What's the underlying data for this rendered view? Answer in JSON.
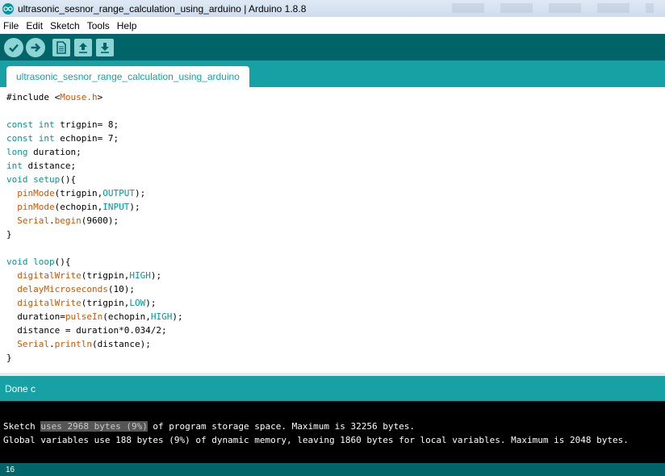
{
  "window": {
    "title": "ultrasonic_sesnor_range_calculation_using_arduino | Arduino 1.8.8",
    "icon": "arduino-logo-icon"
  },
  "menu": [
    "File",
    "Edit",
    "Sketch",
    "Tools",
    "Help"
  ],
  "toolbar": {
    "buttons": [
      "verify-icon",
      "upload-icon",
      "new-icon",
      "open-icon",
      "save-icon"
    ]
  },
  "tabs": [
    "ultrasonic_sesnor_range_calculation_using_arduino"
  ],
  "editor": {
    "lines": [
      "#include <Mouse.h>",
      "",
      "const int trigpin= 8;",
      "const int echopin= 7;",
      "long duration;",
      "int distance;",
      "void setup(){",
      "  pinMode(trigpin,OUTPUT);",
      "  pinMode(echopin,INPUT);",
      "  Serial.begin(9600);",
      "}",
      "",
      "void loop(){",
      "  digitalWrite(trigpin,HIGH);",
      "  delayMicroseconds(10);",
      "  digitalWrite(trigpin,LOW);",
      "  duration=pulseIn(echopin,HIGH);",
      "  distance = duration*0.034/2;",
      "  Serial.println(distance);",
      "}"
    ]
  },
  "status": {
    "message": "Done c"
  },
  "console": {
    "line1_pre": "Sketch ",
    "line1_hl": "uses 2968 bytes (9%)",
    "line1_post": " of program storage space. Maximum is 32256 bytes.",
    "line2": "Global variables use 188 bytes (9%) of dynamic memory, leaving 1860 bytes for local variables. Maximum is 2048 bytes."
  },
  "footer": {
    "line_number": "16"
  },
  "colors": {
    "teal_dark": "#006468",
    "teal": "#17a1a5",
    "keyword": "#00979c",
    "function": "#d35400"
  }
}
